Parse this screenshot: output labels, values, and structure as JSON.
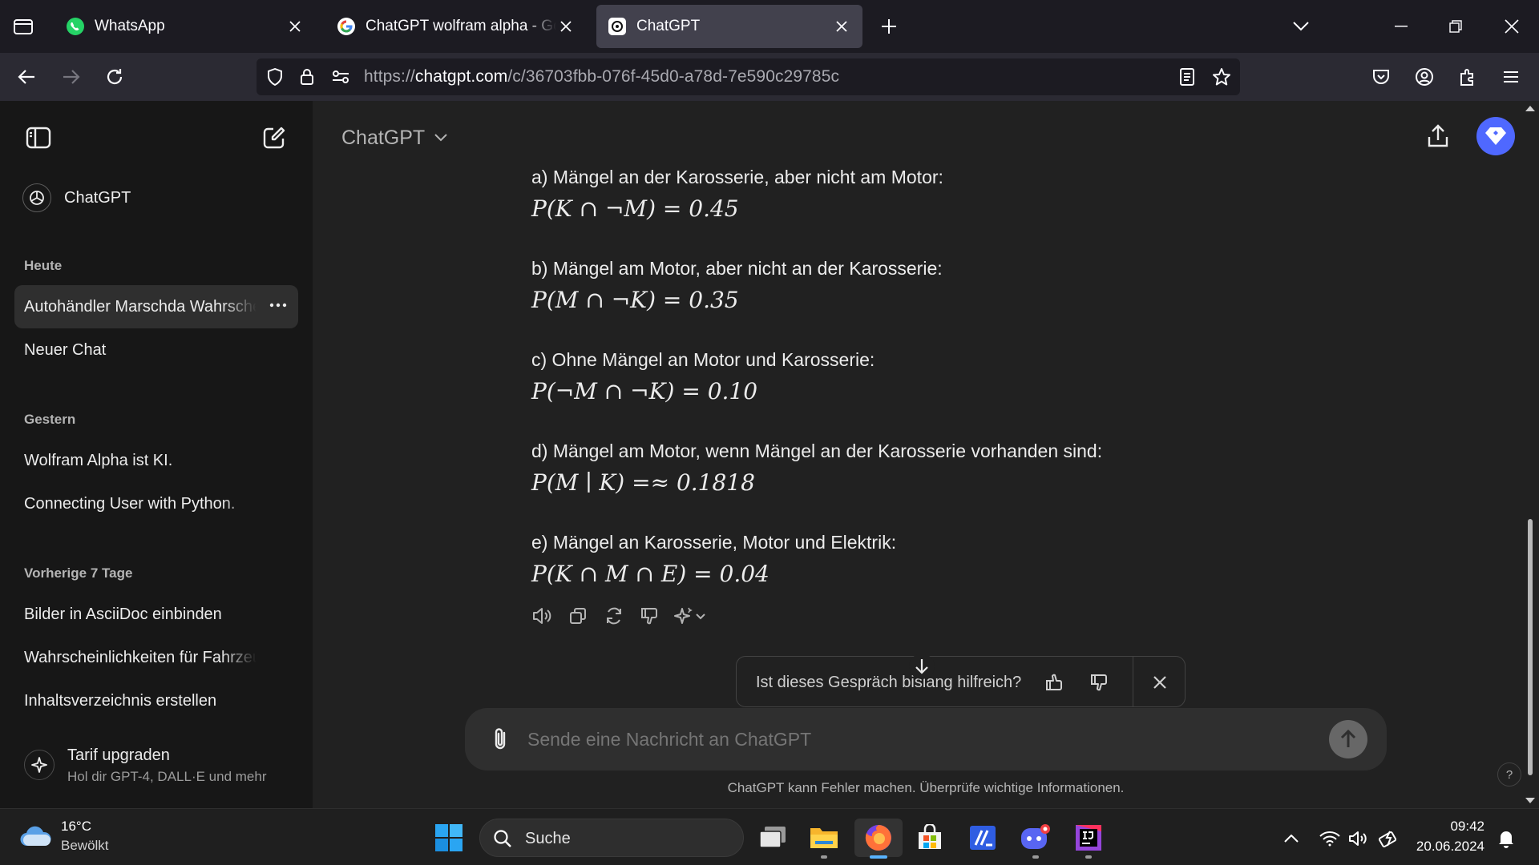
{
  "browser": {
    "tabs": [
      {
        "title": "WhatsApp",
        "icon": "whatsapp-icon",
        "active": false
      },
      {
        "title": "ChatGPT wolfram alpha - Google",
        "icon": "google-icon",
        "active": false
      },
      {
        "title": "ChatGPT",
        "icon": "openai-icon",
        "active": true
      }
    ],
    "url_host": "chatgpt.com",
    "url_prefix": "https://",
    "url_path": "/c/36703fbb-076f-45d0-a78d-7e590c29785c"
  },
  "sidebar": {
    "app_name": "ChatGPT",
    "sections": [
      {
        "label": "Heute",
        "items": [
          "Autohändler Marschda Wahrscheinlichkeiten",
          "Neuer Chat"
        ]
      },
      {
        "label": "Gestern",
        "items": [
          "Wolfram Alpha ist KI.",
          "Connecting User with Python."
        ]
      },
      {
        "label": "Vorherige 7 Tage",
        "items": [
          "Bilder in AsciiDoc einbinden",
          "Wahrscheinlichkeiten für Fahrzeugmängel",
          "Inhaltsverzeichnis erstellen"
        ]
      }
    ],
    "upgrade_title": "Tarif upgraden",
    "upgrade_subtitle": "Hol dir GPT-4, DALL·E und mehr"
  },
  "header": {
    "model": "ChatGPT"
  },
  "answer": [
    {
      "text": "a) Mängel an der Karosserie, aber nicht am Motor:",
      "formula": "P(K ∩ ¬M) = 0.45"
    },
    {
      "text": "b) Mängel am Motor, aber nicht an der Karosserie:",
      "formula": "P(M ∩ ¬K) = 0.35"
    },
    {
      "text": "c) Ohne Mängel an Motor und Karosserie:",
      "formula": "P(¬M ∩ ¬K) = 0.10"
    },
    {
      "text": "d) Mängel am Motor, wenn Mängel an der Karosserie vorhanden sind:",
      "formula": "P(M ∣ K) =≈ 0.1818"
    },
    {
      "text": "e) Mängel an Karosserie, Motor und Elektrik:",
      "formula": "P(K ∩ M ∩ E) = 0.04"
    }
  ],
  "feedback": {
    "question": "Ist dieses Gespräch bislang hilfreich?"
  },
  "composer": {
    "placeholder": "Sende eine Nachricht an ChatGPT"
  },
  "disclaimer": "ChatGPT kann Fehler machen. Überprüfe wichtige Informationen.",
  "help_label": "?",
  "taskbar": {
    "weather_temp": "16°C",
    "weather_desc": "Bewölkt",
    "search_label": "Suche",
    "time": "09:42",
    "date": "20.06.2024"
  },
  "colors": {
    "accent": "#4f68ff",
    "sidebar_bg": "#171717",
    "main_bg": "#212121"
  }
}
